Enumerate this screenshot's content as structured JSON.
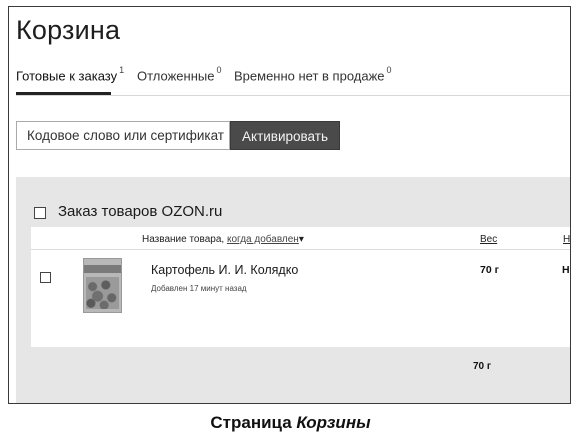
{
  "page": {
    "title": "Корзина"
  },
  "tabs": [
    {
      "label": "Готовые к заказу",
      "count": "1",
      "active": true
    },
    {
      "label": "Отложенные",
      "count": "0",
      "active": false
    },
    {
      "label": "Временно нет в продаже",
      "count": "0",
      "active": false
    }
  ],
  "promo": {
    "placeholder": "Кодовое слово или сертификат",
    "button_label": "Активировать"
  },
  "order": {
    "title": "Заказ товаров OZON.ru",
    "columns": {
      "name_label": "Название товара,",
      "sort_label": "когда добавлен",
      "sort_icon": "▾",
      "weight_label": "Вес",
      "cut_label": "На"
    },
    "items": [
      {
        "name": "Картофель  И. И. Колядко",
        "added": "Добавлен 17 минут назад",
        "weight": "70 г",
        "cut_value": "На"
      }
    ],
    "total_weight": "70 г"
  },
  "caption": {
    "plain": "Страница",
    "italic": "Корзины"
  }
}
